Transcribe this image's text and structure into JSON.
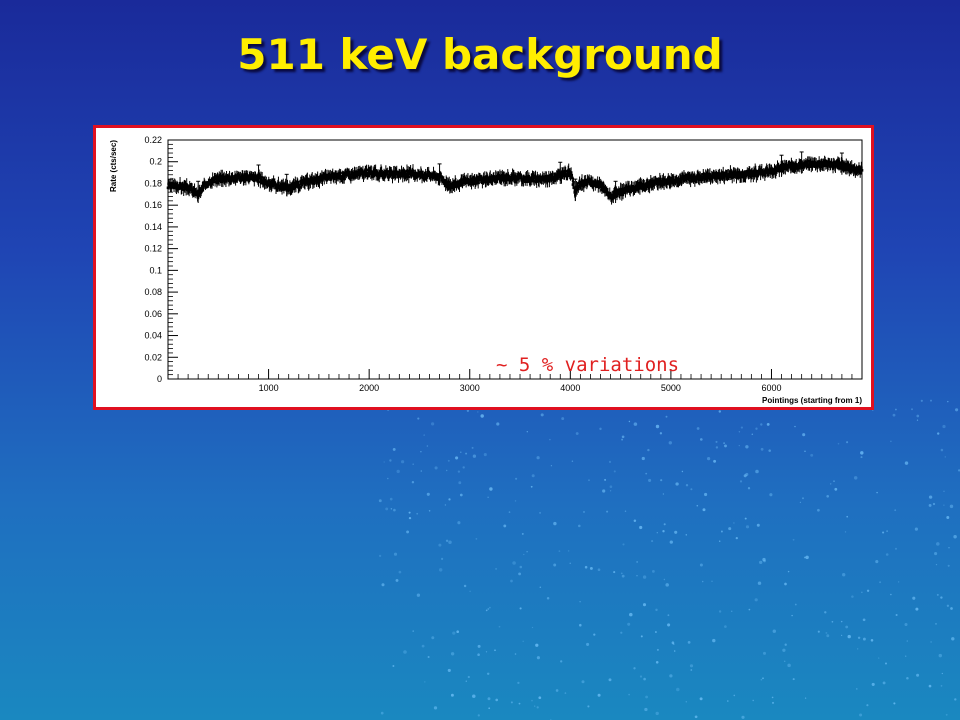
{
  "slide": {
    "title": "511 keV background",
    "annotation": "~ 5 % variations"
  },
  "colors": {
    "title": "#ffee00",
    "panel_border": "#e01020",
    "annotation": "#e02020",
    "data": "#000000"
  },
  "chart_data": {
    "type": "scatter",
    "xlabel": "Pointings (starting from 1)",
    "ylabel": "Rate (cts/sec)",
    "xlim": [
      0,
      6900
    ],
    "ylim": [
      0,
      0.22
    ],
    "xticks": [
      1000,
      2000,
      3000,
      4000,
      5000,
      6000
    ],
    "yticks": [
      0,
      0.02,
      0.04,
      0.06,
      0.08,
      0.1,
      0.12,
      0.14,
      0.16,
      0.18,
      0.2,
      0.22
    ],
    "error_bars": true,
    "grid": false,
    "series": [
      {
        "x": [
          0,
          100,
          200,
          300,
          400,
          500,
          700,
          900,
          1000,
          1100,
          1200,
          1400,
          1600,
          1800,
          2000,
          2200,
          2400,
          2600,
          2700,
          2800,
          3000,
          3200,
          3400,
          3600,
          3800,
          4000,
          4050,
          4100,
          4200,
          4300,
          4400,
          4500,
          4700,
          5000,
          5300,
          5600,
          5900,
          6000,
          6200,
          6400,
          6600,
          6800,
          6880
        ],
        "y": [
          0.177,
          0.178,
          0.176,
          0.17,
          0.182,
          0.184,
          0.186,
          0.185,
          0.18,
          0.178,
          0.176,
          0.182,
          0.186,
          0.188,
          0.19,
          0.188,
          0.189,
          0.188,
          0.186,
          0.178,
          0.182,
          0.184,
          0.186,
          0.184,
          0.185,
          0.19,
          0.172,
          0.18,
          0.181,
          0.178,
          0.168,
          0.172,
          0.178,
          0.183,
          0.186,
          0.188,
          0.19,
          0.192,
          0.196,
          0.198,
          0.198,
          0.194,
          0.192
        ]
      }
    ]
  }
}
